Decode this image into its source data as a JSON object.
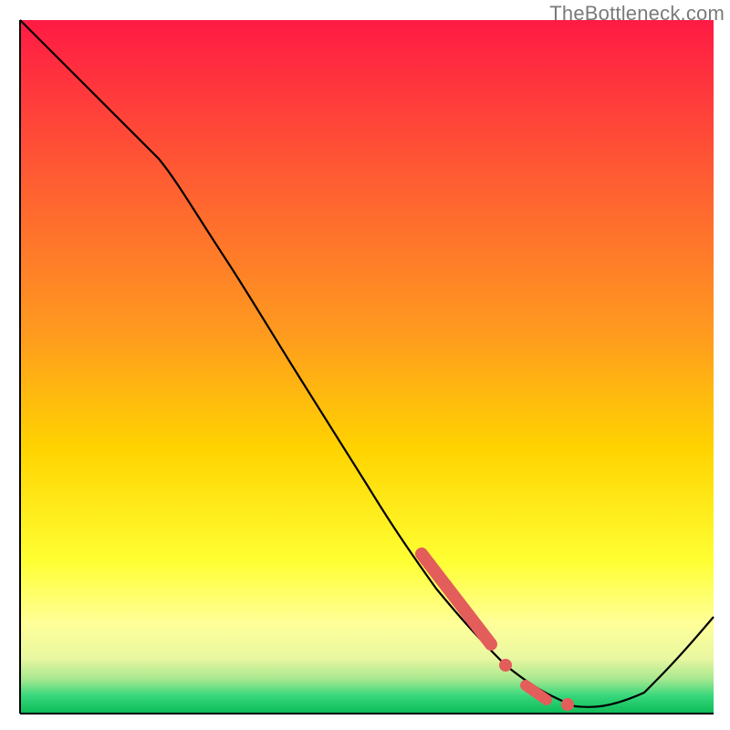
{
  "watermark": "TheBottleneck.com",
  "colors": {
    "axis": "#000000",
    "curve": "#000000",
    "marker": "#e35d5b",
    "gradient_top": "#ff1a44",
    "gradient_mid_upper": "#ff7a2a",
    "gradient_mid": "#ffd400",
    "gradient_yellow_light": "#ffff66",
    "gradient_pale": "#f6fbb0",
    "gradient_green": "#17e36b",
    "gradient_bottom": "#0dbb57"
  },
  "chart_data": {
    "type": "line",
    "title": "",
    "xlabel": "",
    "ylabel": "",
    "xlim": [
      0,
      100
    ],
    "ylim": [
      0,
      100
    ],
    "grid": false,
    "legend": false,
    "background": "heatmap-gradient-vertical",
    "series": [
      {
        "name": "bottleneck-curve",
        "x": [
          0,
          5,
          10,
          15,
          20,
          25,
          30,
          35,
          40,
          45,
          50,
          55,
          60,
          65,
          70,
          75,
          80,
          85,
          90,
          95,
          100
        ],
        "y": [
          100,
          95,
          90,
          85,
          80,
          74,
          65,
          57,
          49,
          41,
          33,
          25,
          18,
          12,
          7,
          3,
          1,
          1,
          3,
          8,
          14
        ]
      }
    ],
    "markers": [
      {
        "name": "highlight-segment-primary",
        "kind": "thick-segment",
        "x_start": 58,
        "x_end": 68,
        "approx_y_start": 23,
        "approx_y_end": 10
      },
      {
        "name": "highlight-dot-a",
        "kind": "dot",
        "x": 70,
        "approx_y": 7
      },
      {
        "name": "highlight-segment-secondary",
        "kind": "short-segment",
        "x_start": 73,
        "x_end": 76,
        "approx_y_start": 4,
        "approx_y_end": 2
      },
      {
        "name": "highlight-dot-b",
        "kind": "dot",
        "x": 79,
        "approx_y": 1
      }
    ]
  }
}
